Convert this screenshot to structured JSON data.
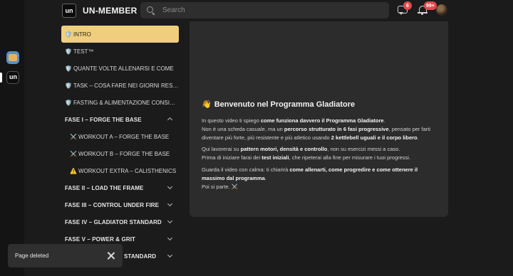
{
  "header": {
    "logo_text": "un",
    "brand": "UN-MEMBER",
    "search_placeholder": "Search",
    "chat_badge": "6",
    "notifications_badge": "99+"
  },
  "rail": {
    "apps": [
      {
        "icon": "app-avatar-icon"
      },
      {
        "icon": "un-logo-icon",
        "text": "un"
      }
    ]
  },
  "sidebar": {
    "items": [
      {
        "emoji": "🛡️",
        "label": "INTRO",
        "type": "page",
        "active": true
      },
      {
        "emoji": "🛡️",
        "label": "TEST™",
        "type": "page"
      },
      {
        "emoji": "🛡️",
        "label": "QUANTE VOLTE ALLENARSI E COME",
        "type": "page"
      },
      {
        "emoji": "🛡️",
        "label": "TASK – COSA FARE NEI GIORNI REST (...",
        "type": "page"
      },
      {
        "emoji": "🛡️",
        "label": "FASTING & ALIMENTAZIONE CONSIGLI...",
        "type": "page"
      },
      {
        "label": "FASE I – FORGE THE BASE",
        "type": "section",
        "expanded": true
      },
      {
        "emoji": "⚔️",
        "label": "WORKOUT A – FORGE THE BASE",
        "type": "sub"
      },
      {
        "emoji": "⚔️",
        "label": "WORKOUT B – FORGE THE BASE",
        "type": "sub"
      },
      {
        "emoji": "⚠️",
        "label": "WORKOUT EXTRA – CALISTHENICS",
        "type": "sub"
      },
      {
        "label": "FASE II – LOAD THE FRAME",
        "type": "section"
      },
      {
        "label": "FASE III – CONTROL UNDER FIRE",
        "type": "section"
      },
      {
        "label": "FASE IV – GLADIATOR STANDARD",
        "type": "section"
      },
      {
        "label": "FASE V – POWER & GRIT",
        "type": "section"
      },
      {
        "label": "STANDARD",
        "type": "section"
      }
    ]
  },
  "content": {
    "title_emoji": "👋",
    "title": "Benvenuto nel Programma Gladiatore",
    "p1_a": "In questo video ti spiego ",
    "p1_b": "come funziona davvero il Programma Gladiatore",
    "p1_c": ".",
    "p1_d": "Non è una scheda casuale, ma un ",
    "p1_e": "percorso strutturato in 6 fasi progressive",
    "p1_f": ", pensato per farti diventare più forte, più resistente e più atletico usando ",
    "p1_g": "2 kettlebell uguali e il corpo libero",
    "p1_h": ".",
    "p2_a": "Qui lavorerai su ",
    "p2_b": "pattern motori, densità e controllo",
    "p2_c": ", non su esercizi messi a caso.",
    "p2_d": "Prima di iniziare farai dei ",
    "p2_e": "test iniziali",
    "p2_f": ", che ripeterai alla fine per misurare i tuoi progressi.",
    "p3_a": "Guarda il video con calma: ti chiarirà ",
    "p3_b": "come allenarti, come progredire e come ottenere il massimo dal programma",
    "p3_c": ".",
    "p3_d": "Poi si parte. ",
    "p3_emoji": "⚔️"
  },
  "toast": {
    "message": "Page deleted"
  }
}
